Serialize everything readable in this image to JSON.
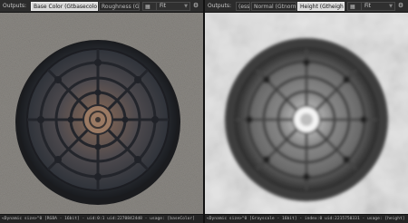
{
  "left_view": {
    "outputs_label": "Outputs:",
    "outputs": [
      "Base Color (Gtbasecolor)",
      "Roughness (G"
    ],
    "active_index": 0,
    "channel_icon": "rgb-channel-icon",
    "zoom": "Fit",
    "menu_icon": "overlay-menu-icon",
    "status": "<Dynamic size>\"0 [RGBA - 16bit] - uid:0:1 uid:22708424d8 - usage: [baseColor]"
  },
  "right_view": {
    "outputs_label": "Outputs:",
    "outputs": [
      "(ess)",
      "Normal (Gtnormal)",
      "Height (Gtheight)"
    ],
    "active_index": 2,
    "channel_icon": "grayscale-channel-icon",
    "zoom": "Fit",
    "menu_icon": "overlay-menu-icon",
    "status": "<Dynamic size>\"0 [Grayscale - 16bit] - index:0 uid:2215750331 - usage: [height]"
  },
  "colors": {
    "active_chip": "#d9d9d9",
    "toolbar_bg": "#2c2c2c",
    "panel_bg": "#262626"
  }
}
